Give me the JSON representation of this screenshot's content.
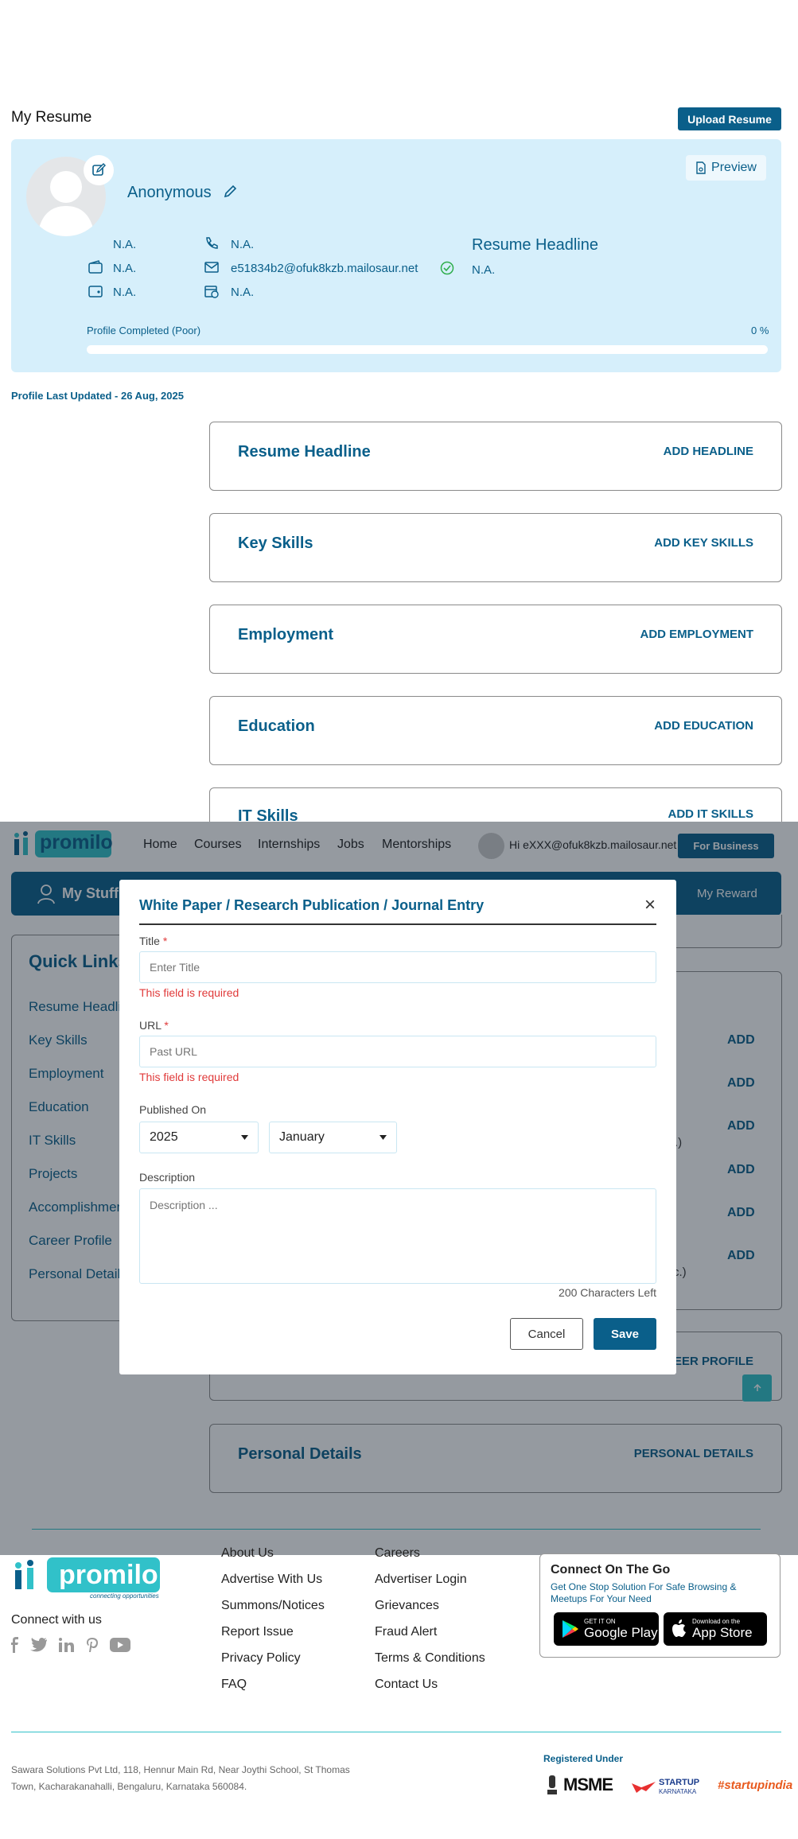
{
  "resume": {
    "title": "My Resume",
    "upload_label": "Upload Resume",
    "preview_label": "Preview",
    "name": "Anonymous",
    "fields": {
      "experience": "N.A.",
      "phone": "N.A.",
      "salary": "N.A.",
      "email": "e51834b2@ofuk8kzb.mailosaur.net",
      "location": "N.A.",
      "notice": "N.A."
    },
    "headline_label": "Resume Headline",
    "headline_value": "N.A.",
    "profile_completed_label": "Profile Completed (Poor)",
    "profile_completed_value": "0 %",
    "progress": 0,
    "last_updated": "Profile Last Updated - 26 Aug, 2025"
  },
  "sections": [
    {
      "title": "Resume Headline",
      "action": "ADD HEADLINE"
    },
    {
      "title": "Key Skills",
      "action": "ADD KEY SKILLS"
    },
    {
      "title": "Employment",
      "action": "ADD EMPLOYMENT"
    },
    {
      "title": "Education",
      "action": "ADD EDUCATION"
    },
    {
      "title": "IT Skills",
      "action": "ADD IT SKILLS"
    },
    {
      "title": "Personal Details",
      "action": "PERSONAL DETAILS"
    }
  ],
  "nav": {
    "items": [
      "Home",
      "Courses",
      "Internships",
      "Jobs",
      "Mentorships"
    ],
    "greeting": "Hi eXXX@ofuk8kzb.mailosaur.net",
    "business_label": "For Business",
    "my_stuff": "My Stuff",
    "my_reward": "My Reward"
  },
  "quick_links": {
    "title": "Quick Links",
    "items": [
      "Resume Headline",
      "Key Skills",
      "Employment",
      "Education",
      "IT Skills",
      "Projects",
      "Accomplishments",
      "Career Profile",
      "Personal Details"
    ]
  },
  "background_actions": [
    "ADD",
    "ADD",
    "ADD",
    "ADD",
    "ADD",
    "ADD"
  ],
  "background_fragments": {
    "frag1": ".)",
    "frag2": "c.)",
    "career_action": "EER PROFILE"
  },
  "modal": {
    "title": "White Paper / Research Publication / Journal Entry",
    "close": "×",
    "title_label": "Title",
    "title_placeholder": "Enter Title",
    "title_error": "This field is required",
    "url_label": "URL",
    "url_placeholder": "Past URL",
    "url_error": "This field is required",
    "required_mark": "*",
    "published_label": "Published On",
    "year": "2025",
    "month": "January",
    "description_label": "Description",
    "description_placeholder": "Description ...",
    "chars_left": "200 Characters Left",
    "cancel_label": "Cancel",
    "save_label": "Save"
  },
  "footer": {
    "connect_with_us": "Connect with us",
    "col1": [
      "About Us",
      "Advertise With Us",
      "Summons/Notices",
      "Report Issue",
      "Privacy Policy",
      "FAQ"
    ],
    "col2": [
      "Careers",
      "Advertiser Login",
      "Grievances",
      "Fraud Alert",
      "Terms & Conditions",
      "Contact Us"
    ],
    "connect_on_the_go": "Connect On The Go",
    "connect_sub": "Get One Stop Solution For Safe Browsing & Meetups For Your Need",
    "google_small": "GET IT ON",
    "google_big": "Google Play",
    "apple_small": "Download on the",
    "apple_big": "App Store",
    "address_line1": "Sawara Solutions Pvt Ltd, 118, Hennur Main Rd, Near Joythi School, St Thomas",
    "address_line2": "Town, Kacharakanahalli, Bengaluru, Karnataka 560084.",
    "registered_under": "Registered Under",
    "msme": "MSME",
    "startup_karnataka_1": "STARTUP",
    "startup_karnataka_2": "KARNATAKA",
    "startupindia": "#startupindia"
  },
  "logo": {
    "text": "promilo",
    "tagline": "connecting opportunities"
  },
  "colors": {
    "brand": "#0a5f8a",
    "card_bg": "#d6effb",
    "error": "#e03a3a",
    "accent": "#31c1c9"
  }
}
